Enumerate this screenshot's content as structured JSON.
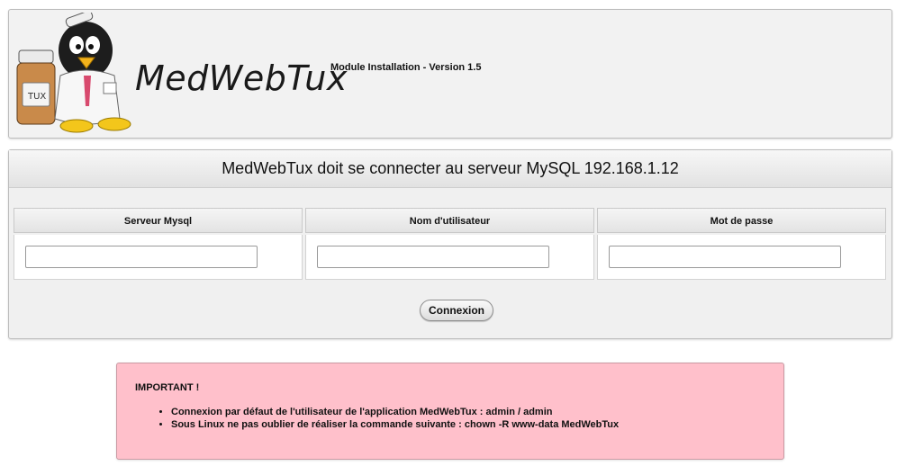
{
  "header": {
    "logo_text": "MedWebTux",
    "logo_bottle_text": "TUX",
    "module_title": "Module Installation - Version 1.5"
  },
  "connect_panel": {
    "title": "MedWebTux doit se connecter au serveur MySQL 192.168.1.12",
    "columns": [
      {
        "label": "Serveur Mysql",
        "value": "",
        "placeholder": ""
      },
      {
        "label": "Nom d'utilisateur",
        "value": "",
        "placeholder": ""
      },
      {
        "label": "Mot de passe",
        "value": "",
        "placeholder": ""
      }
    ],
    "submit_label": "Connexion"
  },
  "notice": {
    "title": "IMPORTANT !",
    "items": [
      "Connexion par défaut de l'utilisateur de l'application MedWebTux : admin / admin",
      "Sous Linux ne pas oublier de réaliser la commande suivante : chown -R www-data MedWebTux"
    ],
    "background": "#ffc0cb"
  }
}
